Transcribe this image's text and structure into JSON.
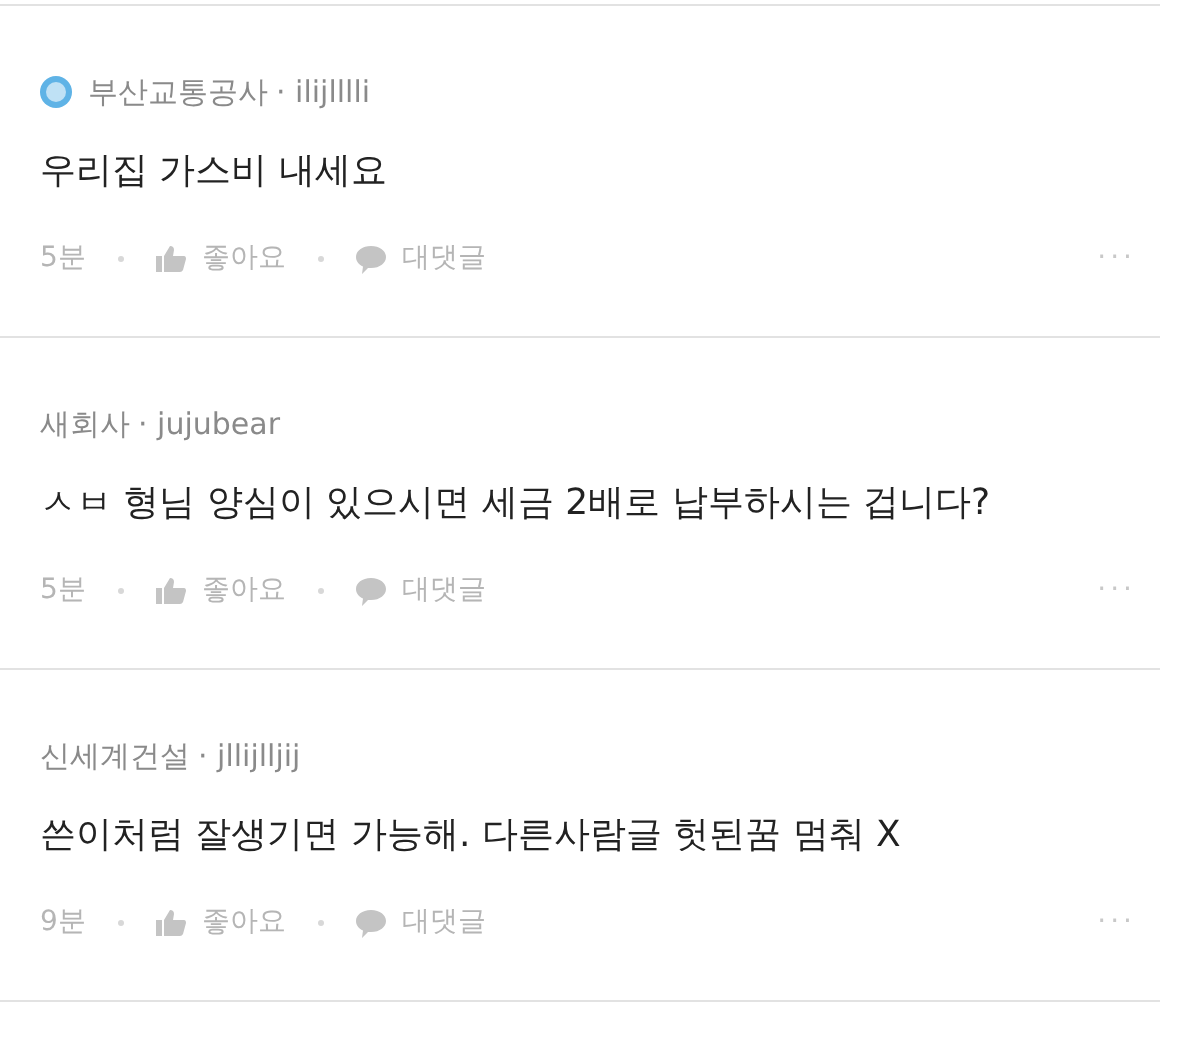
{
  "comments": [
    {
      "has_badge": true,
      "company": "부산교통공사",
      "user": "· ilijlllli",
      "text": "우리집 가스비 내세요",
      "time": "5분",
      "like": "좋아요",
      "reply": "대댓글",
      "more": "···"
    },
    {
      "has_badge": false,
      "company": "새회사",
      "user": "· jujubear",
      "text": "ㅅㅂ 형님 양심이 있으시면 세금 2배로 납부하시는 겁니다?",
      "time": "5분",
      "like": "좋아요",
      "reply": "대댓글",
      "more": "···"
    },
    {
      "has_badge": false,
      "company": "신세계건설",
      "user": "· jllijlljij",
      "text": "쓴이처럼 잘생기면 가능해. 다른사람글 헛된꿈 멈춰 X",
      "time": "9분",
      "like": "좋아요",
      "reply": "대댓글",
      "more": "···"
    }
  ]
}
